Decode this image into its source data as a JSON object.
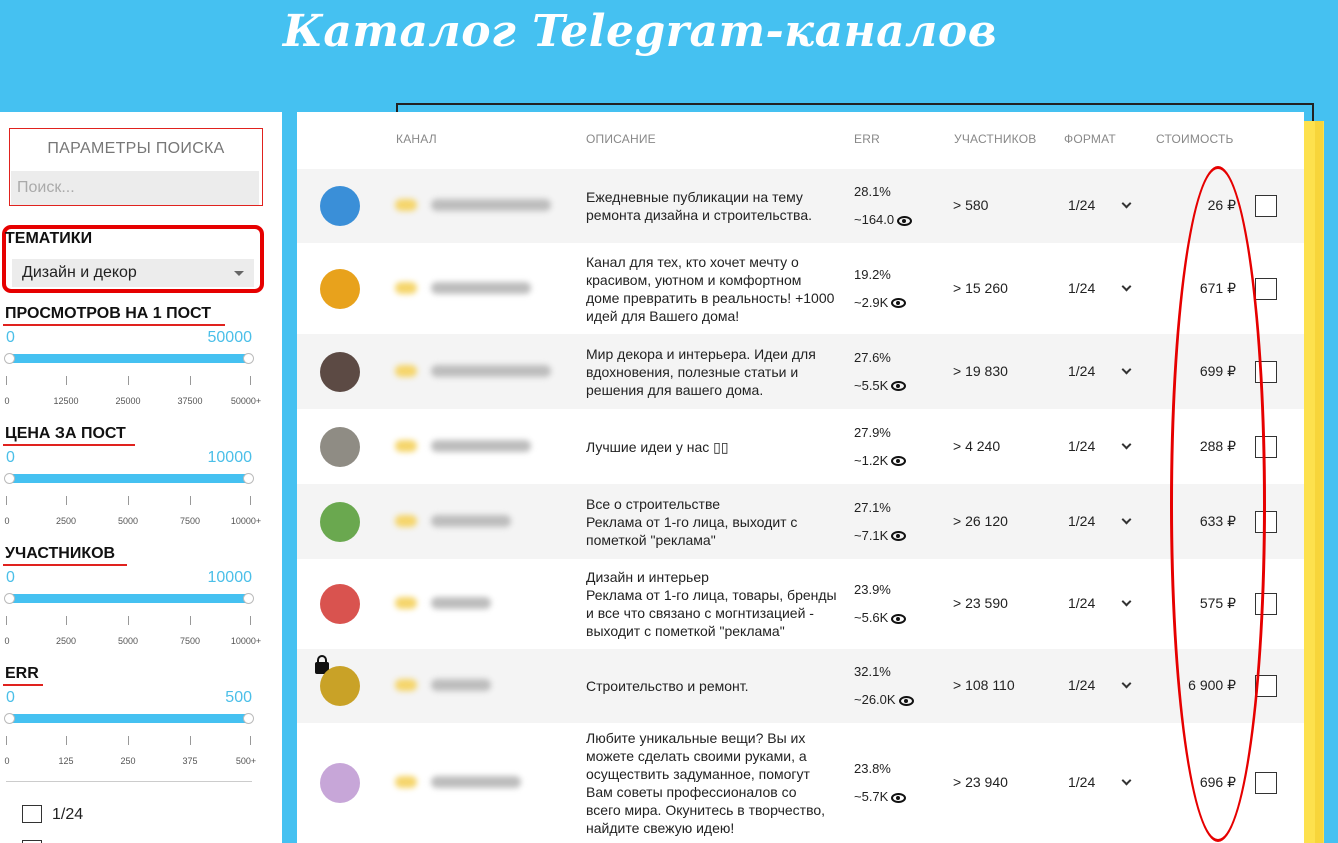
{
  "page_title": "Каталог Telegram-каналов",
  "sidebar": {
    "search": {
      "label": "ПАРАМЕТРЫ ПОИСКА",
      "placeholder": "Поиск..."
    },
    "topics": {
      "title": "ТЕМАТИКИ",
      "selected": "Дизайн и декор"
    },
    "filters": [
      {
        "title": "ПРОСМОТРОВ НА 1 ПОСТ",
        "min": "0",
        "max": "50000",
        "ticks": [
          "0",
          "12500",
          "25000",
          "37500",
          "50000+"
        ]
      },
      {
        "title": "ЦЕНА ЗА ПОСТ",
        "min": "0",
        "max": "10000",
        "ticks": [
          "0",
          "2500",
          "5000",
          "7500",
          "10000+"
        ]
      },
      {
        "title": "УЧАСТНИКОВ",
        "min": "0",
        "max": "10000",
        "ticks": [
          "0",
          "2500",
          "5000",
          "7500",
          "10000+"
        ]
      },
      {
        "title": "ERR",
        "min": "0",
        "max": "500",
        "ticks": [
          "0",
          "125",
          "250",
          "375",
          "500+"
        ]
      }
    ],
    "format_option": "1/24"
  },
  "table": {
    "headers": {
      "channel": "КАНАЛ",
      "description": "ОПИСАНИЕ",
      "err": "ERR",
      "members": "УЧАСТНИКОВ",
      "format": "ФОРМАТ",
      "cost": "СТОИМОСТЬ"
    },
    "rows": [
      {
        "description": "Ежедневные публикации на тему\nремонта дизайна и строительства.",
        "err": "28.1%",
        "views": "~164.0",
        "members": "> 580",
        "format": "1/24",
        "price": "26 ₽",
        "avatar_color": "#3a8fd8",
        "locked": false
      },
      {
        "description": "Канал для тех, кто хочет мечту о\nкрасивом, уютном и комфортном\nдоме превратить в реальность! +1000\nидей для Вашего дома!",
        "err": "19.2%",
        "views": "~2.9K",
        "members": "> 15 260",
        "format": "1/24",
        "price": "671 ₽",
        "avatar_color": "#e8a21c",
        "locked": false
      },
      {
        "description": "Мир декора и интерьера. Идеи для\nвдохновения, полезные статьи и\nрешения для вашего дома.",
        "err": "27.6%",
        "views": "~5.5K",
        "members": "> 19 830",
        "format": "1/24",
        "price": "699 ₽",
        "avatar_color": "#5c4a44",
        "locked": false
      },
      {
        "description": "Лучшие идеи у нас ▯▯",
        "err": "27.9%",
        "views": "~1.2K",
        "members": "> 4 240",
        "format": "1/24",
        "price": "288 ₽",
        "avatar_color": "#8f8c84",
        "locked": false
      },
      {
        "description": "Все о строительстве\nРеклама от 1-го лица, выходит с\nпометкой \"реклама\"",
        "err": "27.1%",
        "views": "~7.1K",
        "members": "> 26 120",
        "format": "1/24",
        "price": "633 ₽",
        "avatar_color": "#6aa84f",
        "locked": false
      },
      {
        "description": "Дизайн и интерьер\nРеклама от 1-го лица, товары, бренды\nи все что связано с могнтизацией -\nвыходит с пометкой \"реклама\"",
        "err": "23.9%",
        "views": "~5.6K",
        "members": "> 23 590",
        "format": "1/24",
        "price": "575 ₽",
        "avatar_color": "#d9534f",
        "locked": false
      },
      {
        "description": "Строительство и ремонт.",
        "err": "32.1%",
        "views": "~26.0K",
        "members": "> 108 110",
        "format": "1/24",
        "price": "6 900 ₽",
        "avatar_color": "#c9a227",
        "locked": true
      },
      {
        "description": "Любите уникальные вещи? Вы их\nможете сделать своими руками, а\nосуществить задуманное, помогут\nВам советы профессионалов со\nвсего мира. Окунитесь в творчество,\nнайдите свежую идею!",
        "err": "23.8%",
        "views": "~5.7K",
        "members": "> 23 940",
        "format": "1/24",
        "price": "696 ₽",
        "avatar_color": "#c7a6d8",
        "locked": false
      }
    ]
  }
}
